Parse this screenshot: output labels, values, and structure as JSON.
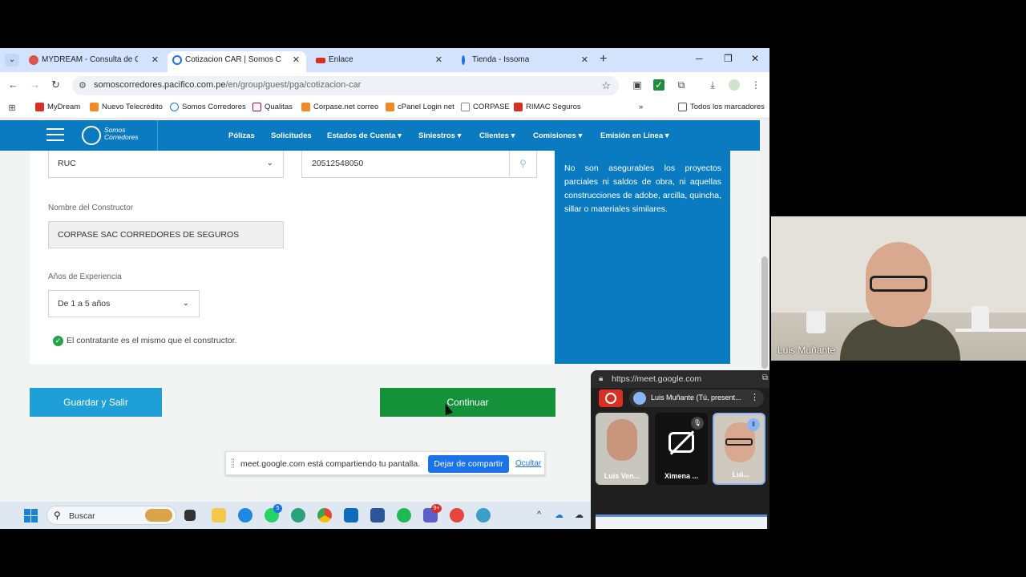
{
  "browser": {
    "tabs": [
      {
        "label": "MYDREAM - Consulta de Gestió",
        "favicon_color": "#d9534f",
        "active": false
      },
      {
        "label": "Cotizacion CAR | Somos Corred",
        "favicon_color": "#1a73e8",
        "active": true
      },
      {
        "label": "Enlace",
        "favicon_color": "#d93025",
        "active": false
      },
      {
        "label": "Tienda - Issoma",
        "favicon_color": "#1a73e8",
        "active": false
      }
    ],
    "tab_close": "✕",
    "new_tab": "+",
    "url_host": "somoscorredores.pacifico.com.pe",
    "url_path": "/en/group/guest/pga/cotizacion-car",
    "bookmarks": [
      {
        "label": "MyDream",
        "color": "#d93025"
      },
      {
        "label": "Nuevo Telecrédito",
        "color": "#f08a24"
      },
      {
        "label": "Somos Corredores",
        "color": "#1a73e8"
      },
      {
        "label": "Qualitas",
        "color": "#b8004c"
      },
      {
        "label": "Corpase.net correo",
        "color": "#f08a24"
      },
      {
        "label": "cPanel Login net",
        "color": "#f08a24"
      },
      {
        "label": "CORPASE",
        "color": "#888888"
      },
      {
        "label": "RIMAC Seguros",
        "color": "#d93025"
      }
    ],
    "bookmarks_more": "»",
    "all_bookmarks": "Todos los marcadores"
  },
  "site": {
    "logo_line1": "Somos",
    "logo_line2": "Corredores",
    "nav": [
      {
        "label": "Pólizas"
      },
      {
        "label": "Solicitudes"
      },
      {
        "label": "Estados de Cuenta ▾"
      },
      {
        "label": "Siniestros ▾"
      },
      {
        "label": "Clientes ▾"
      },
      {
        "label": "Comisiones ▾"
      },
      {
        "label": "Emisión en Línea ▾"
      }
    ]
  },
  "form": {
    "doc_type_value": "RUC",
    "doc_number_value": "20512548050",
    "constructor_label": "Nombre del Constructor",
    "constructor_value": "CORPASE SAC CORREDORES DE SEGUROS",
    "experience_label": "Años de Experiencia",
    "experience_value": "De 1 a 5 años",
    "same_contractor_text": "El contratante es el mismo que el constructor.",
    "info_text": "No son asegurables los proyectos parciales ni saldos de obra, ni aquellas construcciones de adobe, arcilla, quincha, sillar o materiales similares.",
    "save_label": "Guardar y Salir",
    "continue_label": "Continuar"
  },
  "share": {
    "message": "meet.google.com está compartiendo tu pantalla.",
    "stop_label": "Dejar de compartir",
    "hide_label": "Ocultar"
  },
  "taskbar": {
    "search_placeholder": "Buscar",
    "badges": [
      "5",
      "9+"
    ]
  },
  "meet": {
    "camera_name": "Luis Muñante",
    "pip_url": "https://meet.google.com",
    "presenting_text": "Luis Muñante (Tú, present...",
    "tiles": [
      {
        "name": "Luis Ven..."
      },
      {
        "name": "Ximena ..."
      },
      {
        "name": "Lui..."
      }
    ]
  }
}
